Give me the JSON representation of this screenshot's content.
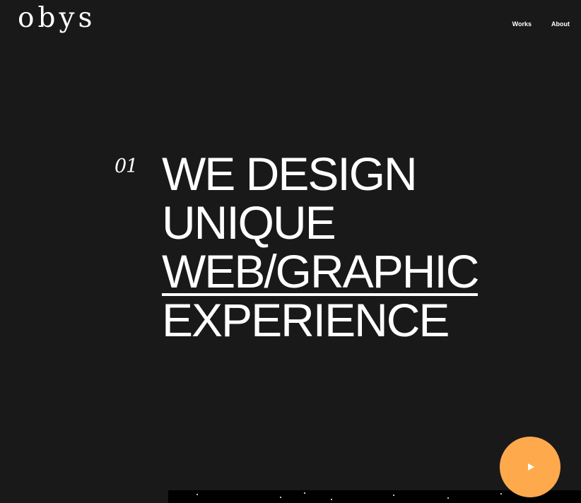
{
  "header": {
    "logo_text": "obys",
    "nav": [
      {
        "label": "Works"
      },
      {
        "label": "About"
      }
    ]
  },
  "hero": {
    "number": "01",
    "lines": [
      "WE DESIGN",
      "UNIQUE",
      "WEB/GRAPHIC",
      "EXPERIENCE"
    ]
  },
  "play_button": {
    "icon": "play-icon",
    "color": "#ffa94d"
  },
  "colors": {
    "background": "#1a1919",
    "text": "#ffffff",
    "accent": "#ffa94d"
  }
}
